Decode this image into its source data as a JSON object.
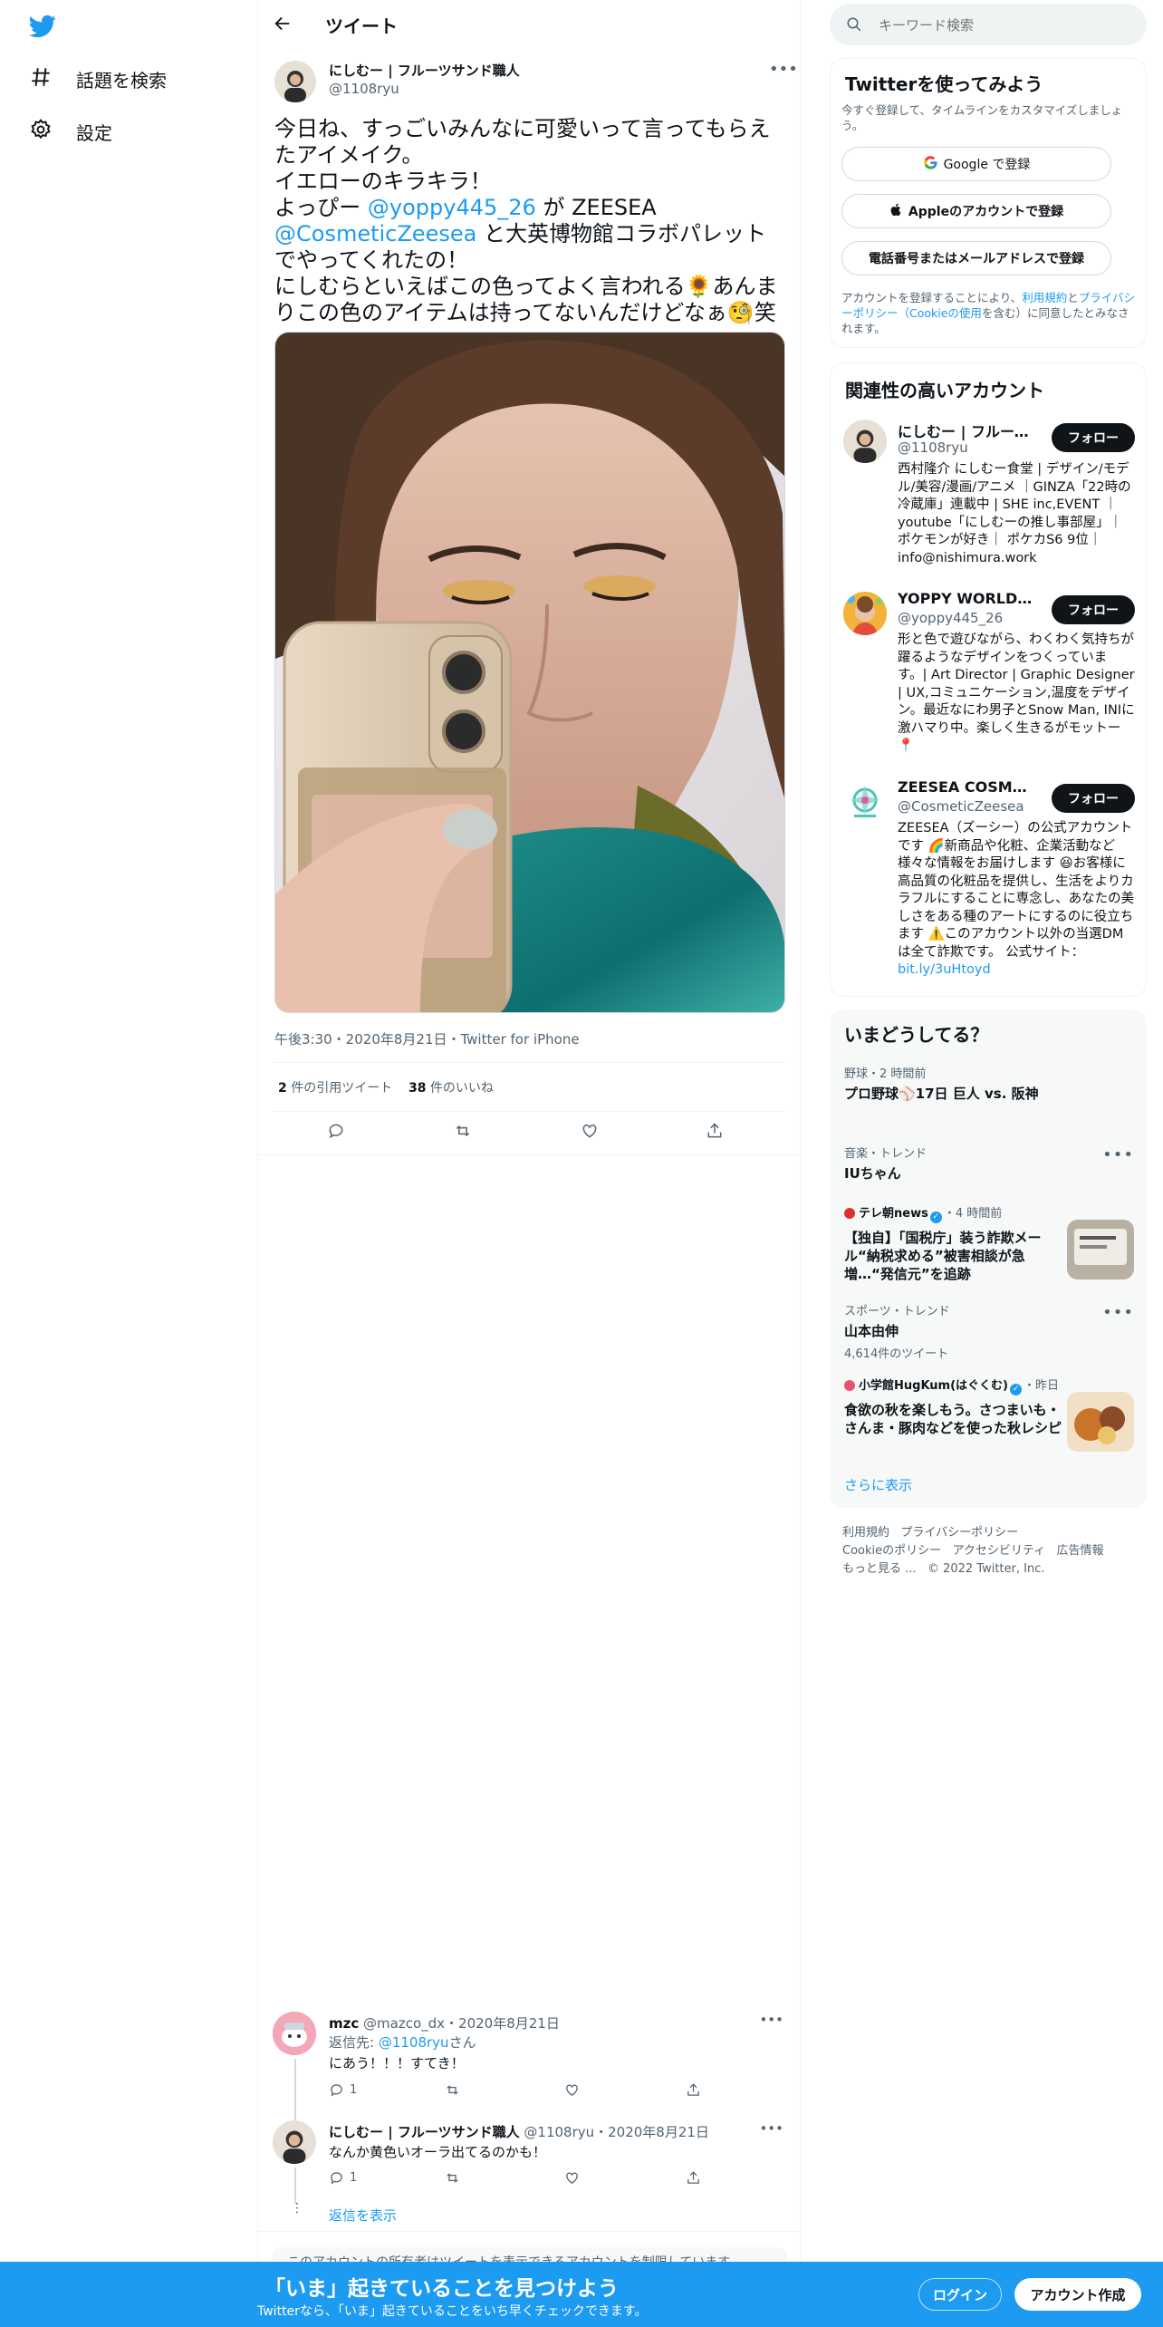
{
  "nav": {
    "explore": "話題を検索",
    "settings": "設定"
  },
  "header": {
    "title": "ツイート"
  },
  "tweet": {
    "author_name": "にしむー | フルーツサンド職人",
    "author_handle": "@1108ryu",
    "text1": "今日ね、すっごいみんなに可愛いって言ってもらえたアイメイク。",
    "text2": "イエローのキラキラ！",
    "text3a": "よっぴー ",
    "mention1": "@yoppy445_26",
    "text3b": " が ZEESEA ",
    "mention2": "@CosmeticZeesea",
    "text3c": " と大英博物館コラボパレットでやってくれたの！",
    "text4a": "にしむらといえばこの色ってよく言われる",
    "emoji1": "🌻",
    "text4b": "あんまりこの色のアイテムは持ってないんだけどなぁ",
    "emoji2": "🧐",
    "text4c": "笑",
    "meta": "午後3:30・2020年8月21日・Twitter for iPhone",
    "quote_count": "2",
    "quote_label": " 件の引用ツイート",
    "like_count": "38",
    "like_label": " 件のいいね"
  },
  "replies": [
    {
      "name": "mzc",
      "handle_date": "@mazco_dx・2020年8月21日",
      "reply_to_prefix": "返信先: ",
      "reply_to_handle": "@1108ryu",
      "reply_to_suffix": "さん",
      "text": "にあう！！！すてき！",
      "reply_count": "1"
    },
    {
      "name": "にしむー | フルーツサンド職人",
      "handle_date": "@1108ryu・2020年8月21日",
      "text": "なんか黄色いオーラ出てるのかも！",
      "reply_count": "1"
    }
  ],
  "show_replies": "返信を表示",
  "hidden_notice": "このアカウントの所有者はツイートを表示できるアカウントを制限しています。",
  "search": {
    "placeholder": "キーワード検索"
  },
  "signup": {
    "title": "Twitterを使ってみよう",
    "subtitle": "今すぐ登録して、タイムラインをカスタマイズしましょう。",
    "google": "Google で登録",
    "apple": "Appleのアカウントで登録",
    "phone": "電話番号またはメールアドレスで登録",
    "terms_a": "アカウントを登録することにより、",
    "terms_link1": "利用規約",
    "terms_b": "と",
    "terms_link2": "プライバシーポリシー（Cookieの使用",
    "terms_c": "を含む）に同意したとみなされます。"
  },
  "related": {
    "title": "関連性の高いアカウント",
    "follow": "フォロー",
    "accounts": [
      {
        "name": "にしむー | フルーツ...",
        "handle": "@1108ryu",
        "bio": "西村隆介 にしむー食堂 | デザイン/モデル/美容/漫画/アニメ ｜GINZA「22時の冷蔵庫」連載中 | SHE inc,EVENT ｜ youtube「にしむーの推し事部屋」｜ ポケモンが好き｜ ポケカS6 9位｜ info@nishimura.work"
      },
      {
        "name": "YOPPY WORLD 🦊",
        "handle": "@yoppy445_26",
        "bio": "形と色で遊びながら、わくわく気持ちが躍るようなデザインをつくっています。| Art Director | Graphic Designer | UX,コミュニケーション,温度をデザイン。最近なにわ男子とSnow Man, INIに激ハマり中。楽しく生きるがモットー📍"
      },
      {
        "name": "ZEESEA COSMETI...",
        "handle": "@CosmeticZeesea",
        "bio": "ZEESEA（ズーシー）の公式アカウントです 🌈新商品や化粧、企業活動など様々な情報をお届けします 😆お客様に高品質の化粧品を提供し、生活をよりカラフルにすることに専念し、あなたの美しさをある種のアートにするのに役立ちます ⚠️このアカウント以外の当選DMは全て詐欺です。 公式サイト：",
        "link": "bit.ly/3uHtoyd"
      }
    ]
  },
  "trends": {
    "title": "いまどうしてる？",
    "items": [
      {
        "meta": "野球・2 時間前",
        "title": "プロ野球⚾17日 巨人 vs. 阪神"
      },
      {
        "meta": "音楽・トレンド",
        "title": "IUちゃん"
      },
      {
        "source": "テレ朝news",
        "meta": "・4 時間前",
        "title": "【独自】「国税庁」装う詐欺メール“納税求める”被害相談が急増…“発信元”を追跡"
      },
      {
        "meta": "スポーツ・トレンド",
        "title": "山本由伸",
        "count": "4,614件のツイート"
      },
      {
        "source": "小学館HugKum(はぐくむ)",
        "meta": "・昨日",
        "title": "食欲の秋を楽しもう。さつまいも・さんま・豚肉などを使った秋レシピ"
      }
    ],
    "more": "さらに表示"
  },
  "footer": {
    "l1": "利用規約",
    "l2": "プライバシーポリシー",
    "l3": "Cookieのポリシー",
    "l4": "アクセシビリティ",
    "l5": "広告情報",
    "l6": "もっと見る ...",
    "copy": "© 2022 Twitter, Inc."
  },
  "banner": {
    "title": "「いま」起きていることを見つけよう",
    "subtitle": "Twitterなら、「いま」起きていることをいち早くチェックできます。",
    "login": "ログイン",
    "signup": "アカウント作成"
  },
  "colors": {
    "accent": "#1d9bf0",
    "text": "#0f1419",
    "muted": "#536471",
    "border": "#eff3f4"
  }
}
